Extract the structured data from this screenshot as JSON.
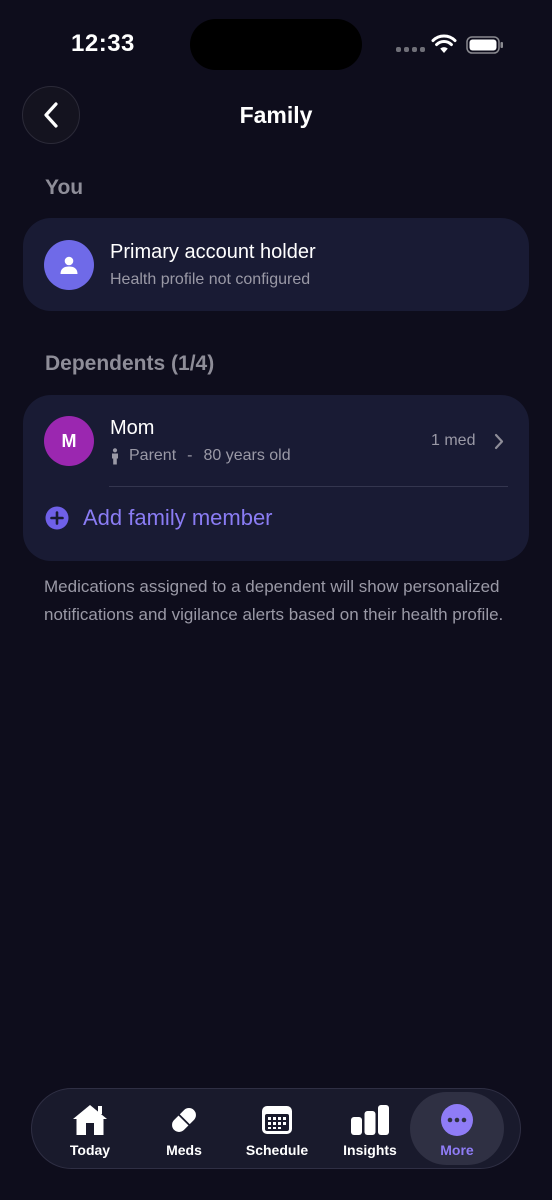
{
  "status_bar": {
    "time": "12:33"
  },
  "header": {
    "title": "Family",
    "back_icon": "chevron-left-icon"
  },
  "you_section": {
    "label": "You",
    "holder": {
      "title": "Primary account holder",
      "subtitle": "Health profile not configured",
      "avatar_color": "#6f6ae8",
      "icon": "person-icon"
    }
  },
  "dependents_section": {
    "label": "Dependents (1/4)",
    "dependents": [
      {
        "initial": "M",
        "name": "Mom",
        "relation": "Parent",
        "separator": "-",
        "age": "80 years old",
        "med_count": "1 med",
        "avatar_color": "#9b27b0"
      }
    ],
    "add_label": "Add family member"
  },
  "footnote": "Medications assigned to a dependent will show personalized notifications and vigilance alerts based on their health profile.",
  "tab_bar": {
    "items": [
      {
        "label": "Today",
        "icon": "home-icon",
        "active": false
      },
      {
        "label": "Meds",
        "icon": "pill-icon",
        "active": false
      },
      {
        "label": "Schedule",
        "icon": "calendar-icon",
        "active": false
      },
      {
        "label": "Insights",
        "icon": "bar-chart-icon",
        "active": false
      },
      {
        "label": "More",
        "icon": "more-icon",
        "active": true
      }
    ]
  },
  "colors": {
    "background": "#0e0d1c",
    "card": "#191b34",
    "accent": "#8a7cf4",
    "secondary_text": "#9a99a6"
  }
}
